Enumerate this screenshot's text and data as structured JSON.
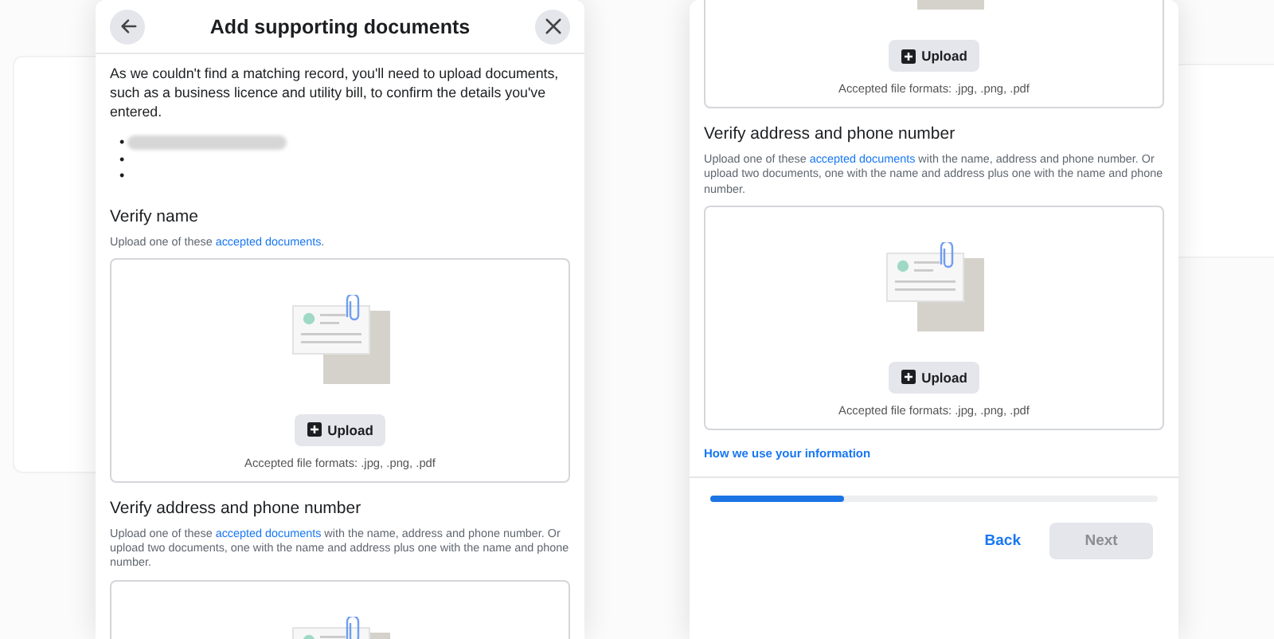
{
  "dialogs": [
    {
      "title": "Add supporting documents",
      "scrolled": false,
      "intro": "As we couldn't find a matching record, you'll need to upload documents, such as a business licence and utility bill, to confirm the details you've entered.",
      "bullets": [
        {
          "mark": "•",
          "redacted": true
        },
        {
          "mark": "•",
          "redacted": false
        },
        {
          "mark": "•",
          "redacted": false
        }
      ],
      "sections": [
        {
          "heading": "Verify name",
          "description": [
            "Upload one of these ",
            "accepted documents",
            "."
          ],
          "upload_button": "Upload",
          "formats": "Accepted file formats: .jpg, .png, .pdf"
        },
        {
          "heading": "Verify address and phone number",
          "description": [
            "Upload one of these ",
            "accepted documents",
            " with the name, address and phone number. Or upload two documents, one with the name and address plus one with the name and phone number."
          ]
        }
      ]
    },
    {
      "scrolled": true,
      "sections": [
        {
          "upload_button": "Upload",
          "formats": "Accepted file formats: .jpg, .png, .pdf"
        },
        {
          "heading": "Verify address and phone number",
          "description": [
            "Upload one of these ",
            "accepted documents",
            " with the name, address and phone number. Or upload two documents, one with the name and address plus one with the name and phone number."
          ],
          "upload_button": "Upload",
          "formats": "Accepted file formats: .jpg, .png, .pdf"
        }
      ],
      "link": "How we use your information",
      "progress": {
        "level": 0.3
      },
      "back": "Back",
      "next": {
        "label": "Next",
        "disabled": true
      }
    }
  ]
}
